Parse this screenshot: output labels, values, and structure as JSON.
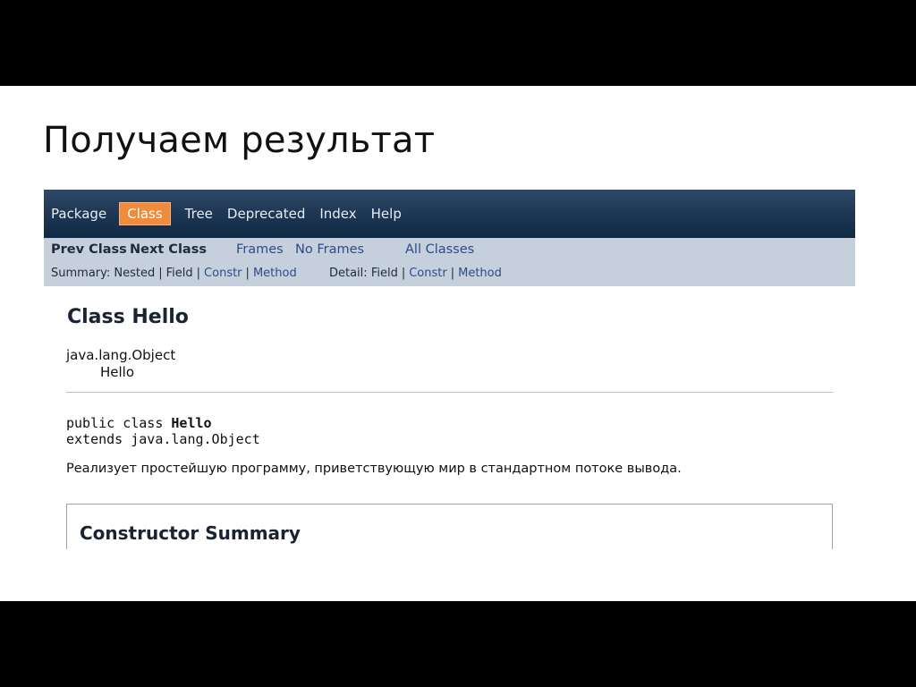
{
  "slide": {
    "title": "Получаем результат"
  },
  "javadoc": {
    "topnav": {
      "items": [
        "Package",
        "Class",
        "Tree",
        "Deprecated",
        "Index",
        "Help"
      ],
      "active": "Class"
    },
    "subnav": {
      "prev_class": "Prev Class",
      "next_class": "Next Class",
      "frames": "Frames",
      "no_frames": "No Frames",
      "all_classes": "All Classes",
      "summary_label": "Summary:",
      "summary_nested": "Nested",
      "summary_field": "Field",
      "summary_constr": "Constr",
      "summary_method": "Method",
      "detail_label": "Detail:",
      "detail_field": "Field",
      "detail_constr": "Constr",
      "detail_method": "Method",
      "separator": "|"
    },
    "class_title": "Class Hello",
    "inheritance": {
      "parent": "java.lang.Object",
      "child": "Hello"
    },
    "declaration": {
      "line1_prefix": "public class ",
      "line1_name": "Hello",
      "line2": "extends java.lang.Object"
    },
    "description": "Реализует простейшую программу, приветствующую мир в стандартном потоке вывода.",
    "constructor_summary_title": "Constructor Summary"
  }
}
